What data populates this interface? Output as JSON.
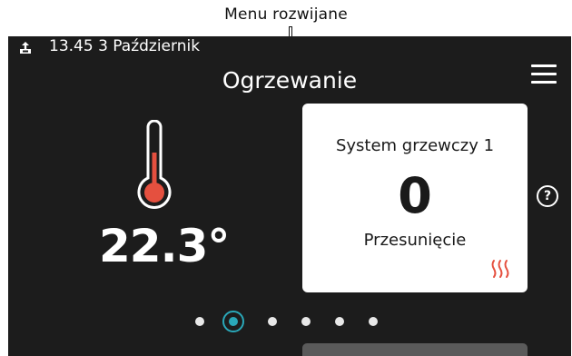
{
  "annotation": {
    "label": "Menu rozwijane"
  },
  "status_bar": {
    "datetime": "13.45 3 Październik",
    "icon": "usb-upload-icon"
  },
  "screen": {
    "title": "Ogrzewanie",
    "temperature": "22.3°",
    "help_label": "?"
  },
  "card": {
    "title": "System grzewczy 1",
    "value": "0",
    "subtitle": "Przesunięcie",
    "icon": "heat-waves-icon"
  },
  "pager": {
    "pages": 6,
    "active_index": 1
  },
  "colors": {
    "background": "#1c1c1c",
    "accent": "#2aa7b8",
    "thermometer": "#e5503f",
    "heat_icon": "#e5503f"
  }
}
